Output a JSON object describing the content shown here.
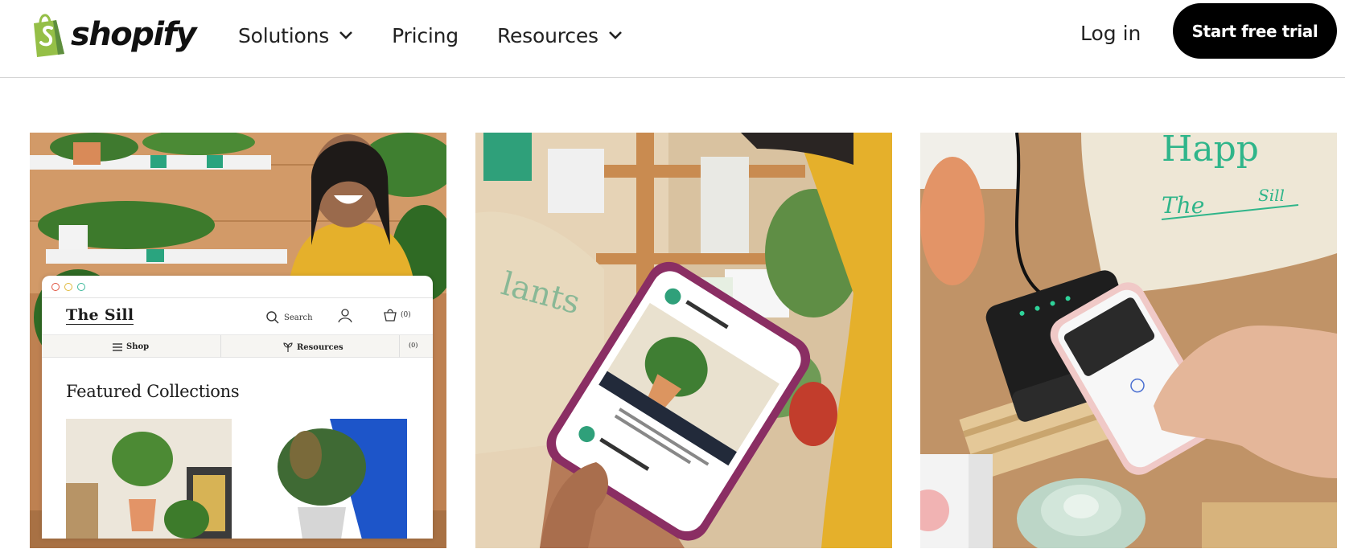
{
  "header": {
    "logo_text": "shopify",
    "nav": [
      {
        "label": "Solutions",
        "has_dropdown": true
      },
      {
        "label": "Pricing",
        "has_dropdown": false
      },
      {
        "label": "Resources",
        "has_dropdown": true
      }
    ],
    "login_label": "Log in",
    "cta_label": "Start free trial"
  },
  "cards": [
    {
      "mockup": {
        "brand": "The  Sill",
        "search_label": "Search",
        "cart_count": "(0)",
        "menu_shop": "Shop",
        "menu_resources": "Resources",
        "menu_cart": "(0)",
        "section_title": "Featured Collections"
      }
    },
    {},
    {}
  ],
  "colors": {
    "brand_green": "#95bf47",
    "brand_green_dark": "#5e8e3e",
    "cta_bg": "#000000",
    "cta_text": "#ffffff"
  },
  "icons": [
    "shopify-bag-icon",
    "chevron-down-icon",
    "search-icon",
    "user-icon",
    "cart-icon",
    "menu-icon"
  ]
}
